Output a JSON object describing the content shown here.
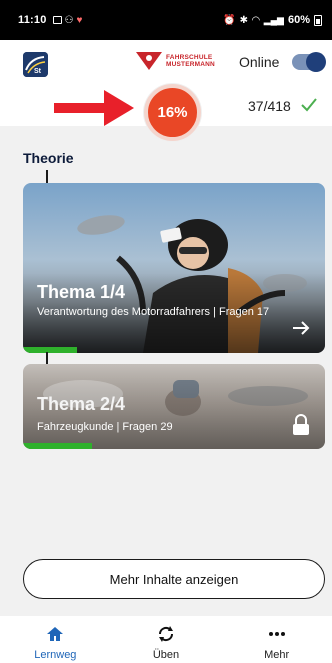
{
  "statusbar": {
    "time": "11:10",
    "battery": "60%"
  },
  "header": {
    "brand_line1": "FAHRSCHULE",
    "brand_line2": "MUSTERMANN",
    "online_label": "Online",
    "online_enabled": true,
    "progress_percent": "16%",
    "progress_count": "37/418"
  },
  "theory": {
    "title": "Theorie",
    "cards": [
      {
        "title": "Thema 1/4",
        "subtitle": "Verantwortung des Motorradfahrers | Fragen 17",
        "progress_fraction": 0.18,
        "locked": false
      },
      {
        "title": "Thema 2/4",
        "subtitle": "Fahrzeugkunde | Fragen 29",
        "progress_fraction": 0.23,
        "locked": true
      }
    ],
    "more_button": "Mehr Inhalte anzeigen"
  },
  "nav": [
    {
      "label": "Lernweg",
      "icon": "home-icon",
      "active": true
    },
    {
      "label": "Üben",
      "icon": "sync-icon",
      "active": false
    },
    {
      "label": "Mehr",
      "icon": "more-icon",
      "active": false
    }
  ],
  "colors": {
    "accent": "#1f66b8",
    "progress_red": "#e94726",
    "progress_green": "#2fb12c",
    "brand_red": "#c8252b",
    "navy": "#1f3f7a"
  }
}
